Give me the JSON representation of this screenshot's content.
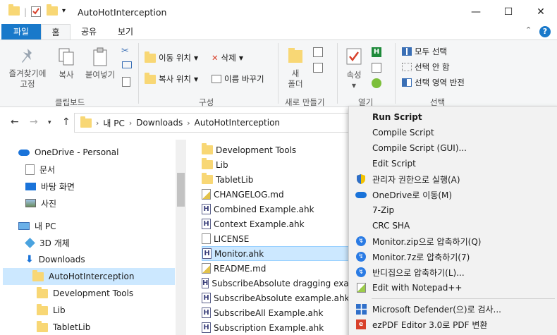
{
  "window": {
    "title": "AutoHotInterception",
    "minimize": "—",
    "maximize": "☐",
    "close": "✕"
  },
  "ribbon_tabs": [
    "파일",
    "홈",
    "공유",
    "보기"
  ],
  "ribbon_controls": {
    "collapse": "⌃",
    "help": "?"
  },
  "ribbon": {
    "clipboard": {
      "pin": "즐겨찾기에\n고정",
      "copy": "복사",
      "paste": "붙여넣기",
      "group": "클립보드"
    },
    "organize": {
      "move_to": "이동 위치",
      "copy_to": "복사 위치",
      "delete": "삭제",
      "rename": "이름 바꾸기",
      "group": "구성"
    },
    "new": {
      "new_folder": "새\n폴더",
      "group": "새로 만들기"
    },
    "open": {
      "properties": "속성",
      "group": "열기"
    },
    "select": {
      "select_all": "모두 선택",
      "select_none": "선택 안 함",
      "invert": "선택 영역 반전",
      "group": "선택"
    }
  },
  "address": {
    "crumbs": [
      "내 PC",
      "Downloads",
      "AutoHotInterception"
    ]
  },
  "nav_pane": [
    {
      "label": "OneDrive - Personal",
      "icon": "cloud-icon"
    },
    {
      "label": "문서",
      "icon": "documents-icon"
    },
    {
      "label": "바탕 화면",
      "icon": "desktop-icon"
    },
    {
      "label": "사진",
      "icon": "pictures-icon"
    },
    {
      "label": "내 PC",
      "icon": "computer-icon"
    },
    {
      "label": "3D 개체",
      "icon": "3d-objects-icon"
    },
    {
      "label": "Downloads",
      "icon": "download-icon"
    },
    {
      "label": "AutoHotInterception",
      "icon": "folder-icon",
      "selected": true
    },
    {
      "label": "Development Tools",
      "icon": "folder-icon"
    },
    {
      "label": "Lib",
      "icon": "folder-icon"
    },
    {
      "label": "TabletLib",
      "icon": "folder-icon"
    }
  ],
  "files": [
    {
      "name": "Development Tools",
      "type": "folder"
    },
    {
      "name": "Lib",
      "type": "folder"
    },
    {
      "name": "TabletLib",
      "type": "folder"
    },
    {
      "name": "CHANGELOG.md",
      "type": "md"
    },
    {
      "name": "Combined Example.ahk",
      "type": "ahk"
    },
    {
      "name": "Context Example.ahk",
      "type": "ahk"
    },
    {
      "name": "LICENSE",
      "type": "doc"
    },
    {
      "name": "Monitor.ahk",
      "type": "ahk",
      "selected": true
    },
    {
      "name": "README.md",
      "type": "md"
    },
    {
      "name": "SubscribeAbsolute dragging examp",
      "type": "ahk"
    },
    {
      "name": "SubscribeAbsolute example.ahk",
      "type": "ahk"
    },
    {
      "name": "SubscribeAll Example.ahk",
      "type": "ahk"
    },
    {
      "name": "Subscription Example.ahk",
      "type": "ahk"
    }
  ],
  "context_menu": [
    {
      "label": "Run Script",
      "bold": true,
      "icon": ""
    },
    {
      "label": "Compile Script",
      "icon": ""
    },
    {
      "label": "Compile Script (GUI)...",
      "icon": ""
    },
    {
      "label": "Edit Script",
      "icon": ""
    },
    {
      "label": "관리자 권한으로 실행(A)",
      "icon": "shield-icon"
    },
    {
      "label": "OneDrive로 이동(M)",
      "icon": "cloud-icon"
    },
    {
      "label": "7-Zip",
      "icon": ""
    },
    {
      "label": "CRC SHA",
      "icon": ""
    },
    {
      "label": "Monitor.zip으로 압축하기(Q)",
      "icon": "bandizip-icon"
    },
    {
      "label": "Monitor.7z로 압축하기(7)",
      "icon": "bandizip-icon"
    },
    {
      "label": "반디집으로 압축하기(L)...",
      "icon": "bandizip-icon"
    },
    {
      "label": "Edit with Notepad++",
      "icon": "notepadpp-icon"
    },
    {
      "label": "Microsoft Defender(으)로 검사...",
      "icon": "defender-icon"
    },
    {
      "label": "ezPDF Editor 3.0로 PDF 변환",
      "icon": "ezpdf-icon"
    }
  ],
  "colors": {
    "accent": "#1979ca",
    "selection": "#cce8ff",
    "folder": "#f8d775"
  }
}
